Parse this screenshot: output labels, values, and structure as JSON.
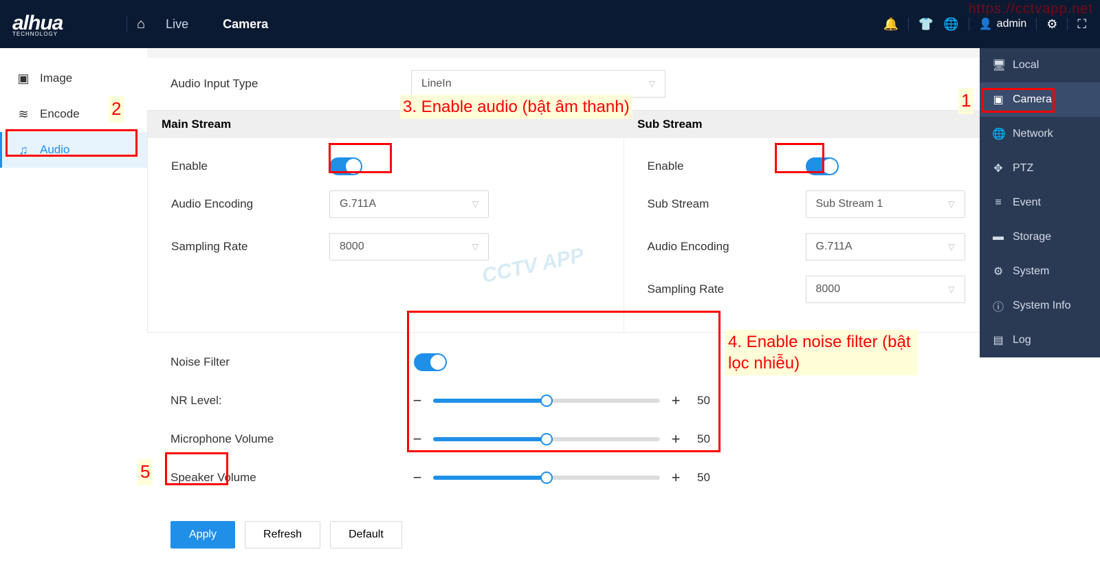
{
  "logo": {
    "brand": "alhua",
    "sub": "TECHNOLOGY"
  },
  "topTabs": {
    "live": "Live",
    "camera": "Camera"
  },
  "user": {
    "name": "admin"
  },
  "leftnav": {
    "image": "Image",
    "encode": "Encode",
    "audio": "Audio"
  },
  "rightnav": {
    "local": "Local",
    "camera": "Camera",
    "network": "Network",
    "ptz": "PTZ",
    "event": "Event",
    "storage": "Storage",
    "system": "System",
    "sysinfo": "System Info",
    "log": "Log"
  },
  "audio": {
    "inputTypeLabel": "Audio Input Type",
    "inputTypeValue": "LineIn",
    "mainStreamTitle": "Main Stream",
    "subStreamTitle": "Sub Stream",
    "enableLabel": "Enable",
    "audioEncodingLabel": "Audio Encoding",
    "audioEncodingValue": "G.711A",
    "samplingRateLabel": "Sampling Rate",
    "samplingRateValue": "8000",
    "subStreamLabel": "Sub Stream",
    "subStreamValue": "Sub Stream 1",
    "noiseFilterLabel": "Noise Filter",
    "nrLevelLabel": "NR Level:",
    "micVolLabel": "Microphone Volume",
    "spkVolLabel": "Speaker Volume",
    "nrLevel": "50",
    "micVol": "50",
    "spkVol": "50"
  },
  "buttons": {
    "apply": "Apply",
    "refresh": "Refresh",
    "default": "Default"
  },
  "annotations": {
    "n1": "1",
    "n2": "2",
    "n3": "3. Enable audio (bật âm thanh)",
    "n4": "4. Enable noise filter (bật lọc nhiễu)",
    "n5": "5",
    "url": "https://cctvapp.net",
    "wm": "CCTV APP"
  }
}
